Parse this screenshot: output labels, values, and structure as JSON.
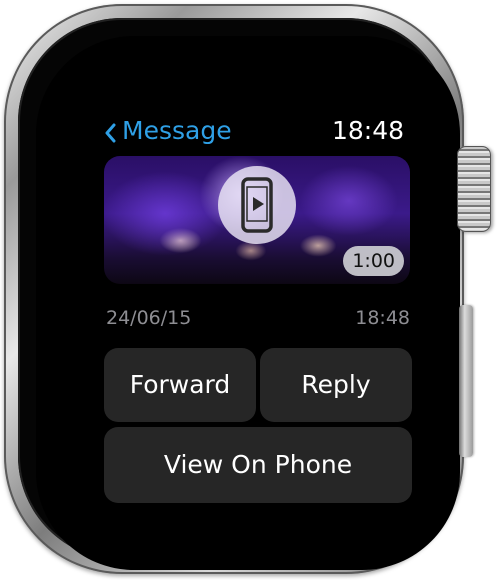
{
  "header": {
    "back_label": "Message",
    "clock": "18:48"
  },
  "video": {
    "duration": "1:00"
  },
  "meta": {
    "date": "24/06/15",
    "time": "18:48"
  },
  "actions": {
    "forward": "Forward",
    "reply": "Reply",
    "view_on_phone": "View On Phone"
  },
  "colors": {
    "accent": "#2fa0e6",
    "button_bg": "#262626",
    "secondary_text": "#8e8e93"
  },
  "icons": {
    "back": "chevron-left-icon",
    "play_on_phone": "phone-play-icon"
  }
}
